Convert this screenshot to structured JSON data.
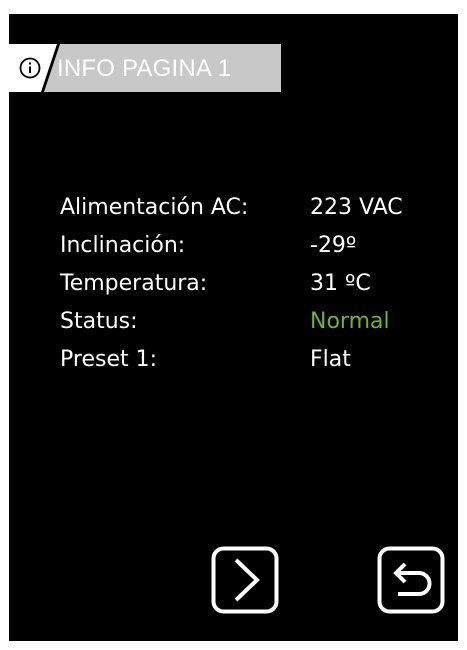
{
  "header": {
    "icon": "info-icon",
    "title": "INFO PAGINA 1",
    "tab_color": "#c8c8c8"
  },
  "info": {
    "rows": [
      {
        "label": "Alimentación AC:",
        "value": "223 VAC"
      },
      {
        "label": "Inclinación:",
        "value": "-29º"
      },
      {
        "label": "Temperatura:",
        "value": "31 ºC"
      },
      {
        "label": "Status:",
        "value": "Normal"
      },
      {
        "label": "Preset 1:",
        "value": "Flat"
      }
    ]
  },
  "colors": {
    "screen_background": "#000000",
    "text": "#ffffff",
    "status_ok": "#6bb23f"
  },
  "buttons": {
    "next": {
      "icon": "chevron-right-icon"
    },
    "back": {
      "icon": "return-arrow-icon"
    }
  }
}
